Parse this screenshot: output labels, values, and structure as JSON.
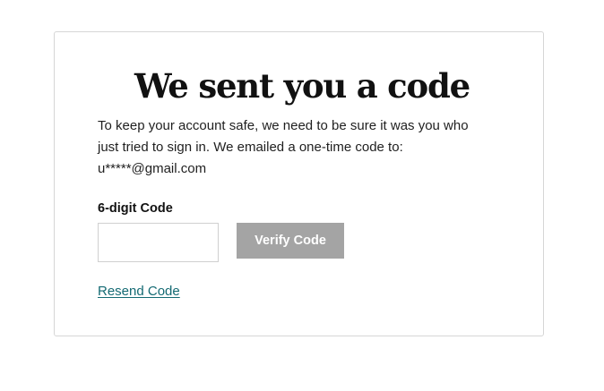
{
  "card": {
    "title": "We sent you a code",
    "description_lines": [
      "To keep your account safe, we need to be sure it was you who",
      "just tried to sign in. We emailed a one-time code to:",
      "u*****@gmail.com"
    ],
    "code_field": {
      "label": "6-digit Code",
      "value": "",
      "placeholder": ""
    },
    "verify_button_label": "Verify Code",
    "resend_link_label": "Resend Code"
  },
  "colors": {
    "link": "#146a73",
    "button_disabled": "#a4a4a4",
    "card_border": "#d6d6d6"
  }
}
